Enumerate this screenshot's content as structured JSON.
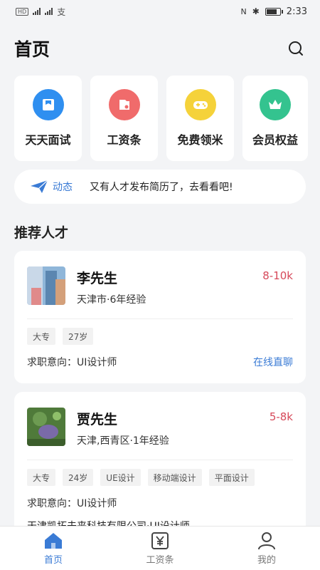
{
  "status_bar": {
    "left_text": "HD 4G 26",
    "time": "2:33",
    "battery_level": 0.7
  },
  "header": {
    "title": "首页"
  },
  "quick_actions": [
    {
      "label": "天天面试",
      "icon": "interview-icon",
      "color": "#2f8ff0"
    },
    {
      "label": "工资条",
      "icon": "payslip-icon",
      "color": "#f06b6b"
    },
    {
      "label": "免费领米",
      "icon": "gamepad-icon",
      "color": "#f5d23a"
    },
    {
      "label": "会员权益",
      "icon": "crown-icon",
      "color": "#34c38f"
    }
  ],
  "notice": {
    "tag": "动态",
    "text": "又有人才发布简历了，去看看吧!"
  },
  "section": {
    "title": "推荐人才"
  },
  "candidates": [
    {
      "name": "李先生",
      "salary": "8-10k",
      "meta": "天津市·6年经验",
      "tags": [
        "大专",
        "27岁"
      ],
      "intent": "求职意向：UI设计师",
      "action": "在线直聊"
    },
    {
      "name": "贾先生",
      "salary": "5-8k",
      "meta": "天津,西青区·1年经验",
      "tags": [
        "大专",
        "24岁",
        "UE设计",
        "移动端设计",
        "平面设计"
      ],
      "intent": "求职意向：UI设计师",
      "company": "天津凯拓未来科技有限公司·UI设计师"
    }
  ],
  "tabbar": {
    "items": [
      {
        "label": "首页",
        "icon": "home-icon"
      },
      {
        "label": "工资条",
        "icon": "yen-receipt-icon"
      },
      {
        "label": "我的",
        "icon": "user-icon"
      }
    ],
    "active": "首页",
    "accent": "#3a7bd5"
  }
}
